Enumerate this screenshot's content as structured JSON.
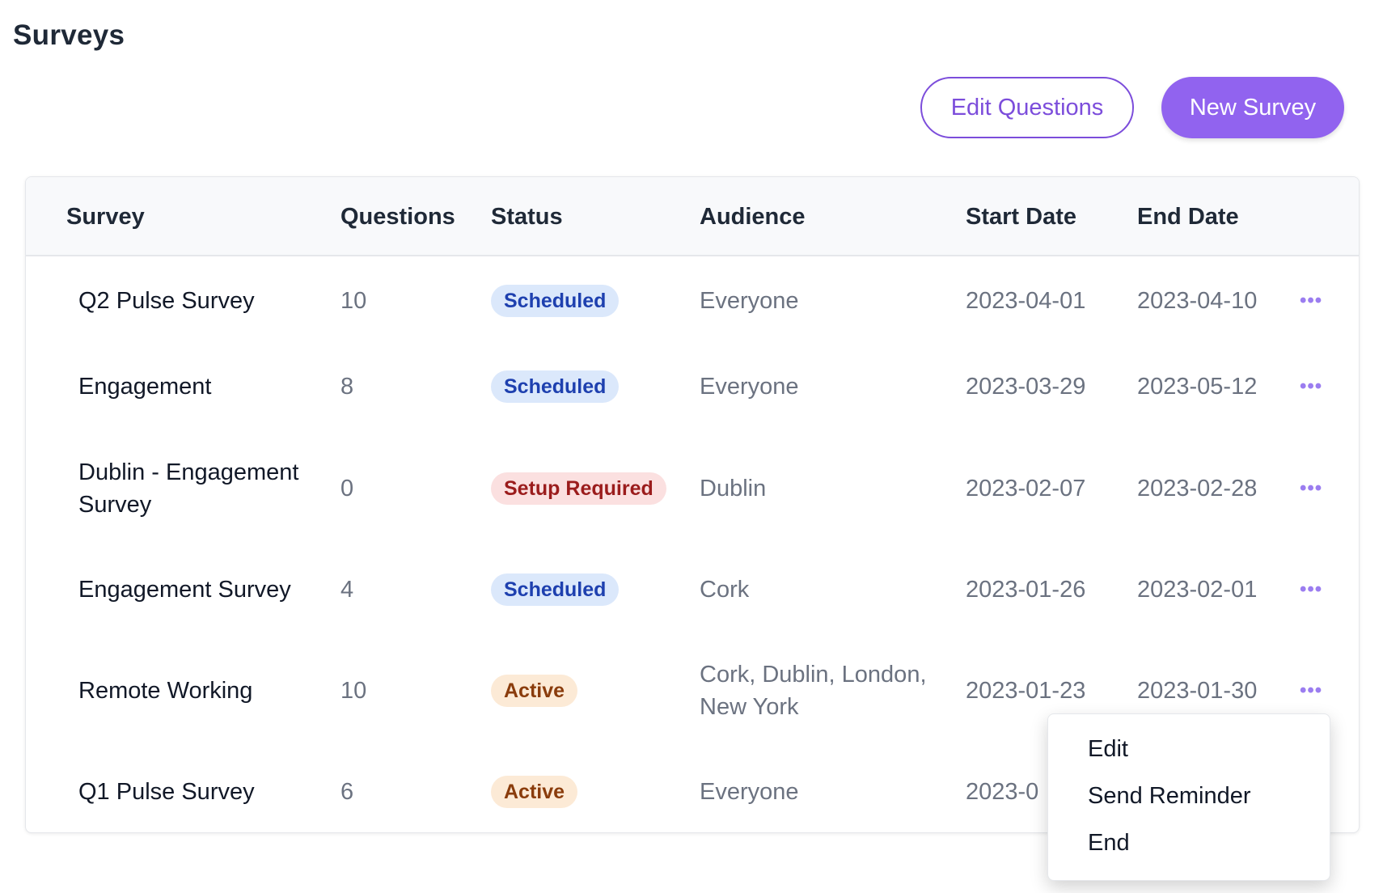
{
  "page": {
    "title": "Surveys"
  },
  "toolbar": {
    "edit_questions_label": "Edit Questions",
    "new_survey_label": "New Survey"
  },
  "colors": {
    "accent": "#9163ef",
    "accent_outline": "#7c4ddb",
    "scheduled_bg": "#dbe8fb",
    "setup_bg": "#fbe0e0",
    "active_bg": "#fcead6"
  },
  "table": {
    "headers": [
      "Survey",
      "Questions",
      "Status",
      "Audience",
      "Start Date",
      "End Date"
    ],
    "rows": [
      {
        "name": "Q2 Pulse Survey",
        "questions": "10",
        "status": "Scheduled",
        "status_kind": "scheduled",
        "audience": "Everyone",
        "start": "2023-04-01",
        "end": "2023-04-10",
        "more_icon": "ellipsis-icon"
      },
      {
        "name": "Engagement",
        "questions": "8",
        "status": "Scheduled",
        "status_kind": "scheduled",
        "audience": "Everyone",
        "start": "2023-03-29",
        "end": "2023-05-12",
        "more_icon": "ellipsis-icon"
      },
      {
        "name": "Dublin - Engagement Survey",
        "questions": "0",
        "status": "Setup Required",
        "status_kind": "setup",
        "audience": "Dublin",
        "start": "2023-02-07",
        "end": "2023-02-28",
        "more_icon": "ellipsis-icon"
      },
      {
        "name": "Engagement Survey",
        "questions": "4",
        "status": "Scheduled",
        "status_kind": "scheduled",
        "audience": "Cork",
        "start": "2023-01-26",
        "end": "2023-02-01",
        "more_icon": "ellipsis-icon"
      },
      {
        "name": "Remote Working",
        "questions": "10",
        "status": "Active",
        "status_kind": "active",
        "audience": "Cork, Dublin, London, New York",
        "start": "2023-01-23",
        "end": "2023-01-30",
        "more_icon": "ellipsis-icon"
      },
      {
        "name": "Q1 Pulse Survey",
        "questions": "6",
        "status": "Active",
        "status_kind": "active",
        "audience": "Everyone",
        "start": "2023-0",
        "end": "",
        "more_icon": "ellipsis-icon"
      }
    ]
  },
  "context_menu": {
    "items": [
      "Edit",
      "Send Reminder",
      "End"
    ]
  }
}
